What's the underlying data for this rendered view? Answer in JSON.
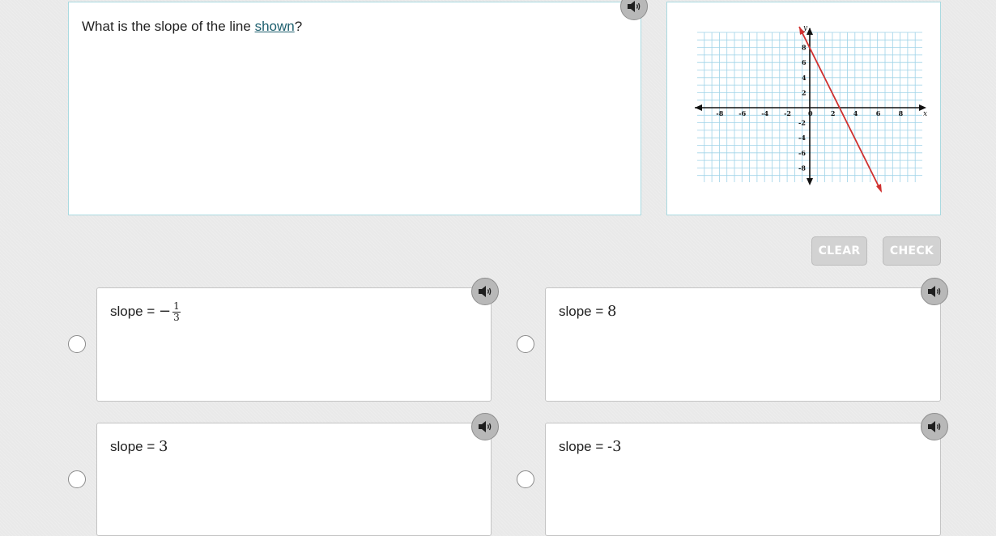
{
  "question": {
    "text_before": "What is the slope of the line ",
    "link_text": "shown",
    "text_after": "?"
  },
  "graph": {
    "x_label": "x",
    "y_label": "y",
    "x_ticks": [
      "-8",
      "-6",
      "-4",
      "-2",
      "0",
      "2",
      "4",
      "6",
      "8"
    ],
    "y_ticks": [
      "8",
      "6",
      "4",
      "2",
      "-2",
      "-4",
      "-6",
      "-8"
    ],
    "line_color": "#d0302f",
    "grid_color": "#9fd3e8"
  },
  "buttons": {
    "clear_label": "CLEAR",
    "check_label": "CHECK"
  },
  "choices": [
    {
      "prefix": "slope = ",
      "sign": "−",
      "numerator": "1",
      "denominator": "3"
    },
    {
      "prefix": "slope = ",
      "value": "8"
    },
    {
      "prefix": "slope = ",
      "value": "3"
    },
    {
      "prefix": "slope = ",
      "value": "-3"
    }
  ]
}
